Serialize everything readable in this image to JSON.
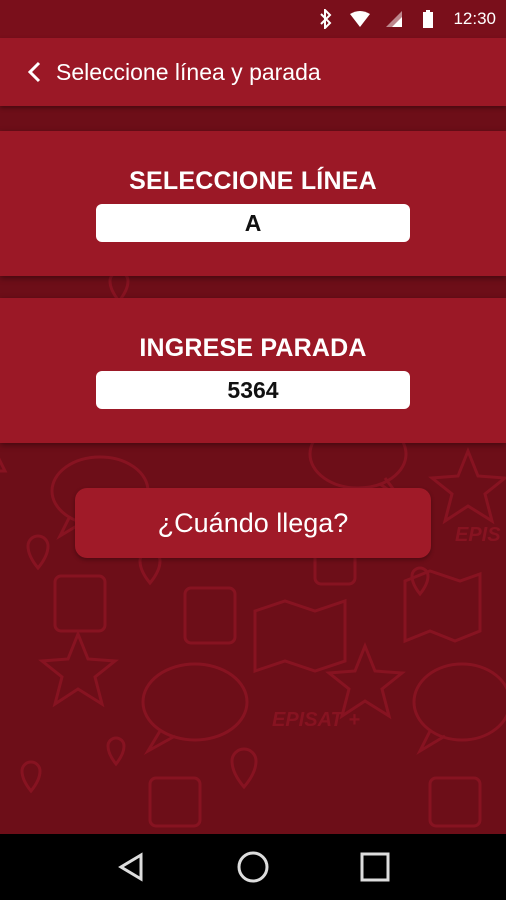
{
  "status_bar": {
    "time": "12:30",
    "icons": [
      "bluetooth-icon",
      "wifi-icon",
      "signal-icon",
      "battery-icon"
    ]
  },
  "app_bar": {
    "back_icon": "chevron-left-icon",
    "title": "Seleccione línea y parada"
  },
  "line_section": {
    "label": "SELECCIONE LÍNEA",
    "value": "A"
  },
  "stop_section": {
    "label": "INGRESE PARADA",
    "value": "5364"
  },
  "action": {
    "label": "¿Cuándo llega?"
  },
  "nav_bar": {
    "icons": [
      "back-triangle-icon",
      "home-circle-icon",
      "recents-square-icon"
    ]
  },
  "colors": {
    "primary": "#9b1826",
    "background": "#6d0e18",
    "status_bar": "#7a0f1b"
  }
}
